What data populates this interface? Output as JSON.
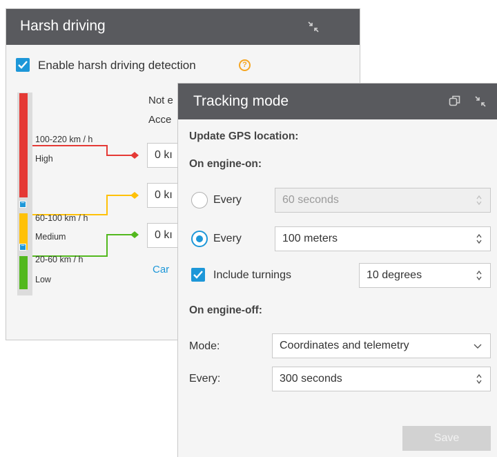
{
  "harsh": {
    "title": "Harsh driving",
    "enable_label": "Enable harsh driving detection",
    "help_glyph": "?",
    "cut_text_1": "Not e",
    "cut_text_2": "Acce",
    "ranges": [
      {
        "speed": "100-220 km / h",
        "level": "High",
        "color": "#e53935"
      },
      {
        "speed": "60-100 km / h",
        "level": "Medium",
        "color": "#ffc107"
      },
      {
        "speed": "20-60 km / h",
        "level": "Low",
        "color": "#52b81d"
      }
    ],
    "field_partial": [
      "0  kı",
      "0  kı",
      "0  kı"
    ],
    "link_partial": "Car",
    "minus_glyph": "−"
  },
  "tracking": {
    "title": "Tracking mode",
    "update_heading": "Update GPS location:",
    "engine_on_heading": "On engine-on:",
    "every_label": "Every",
    "every_seconds_value": "60  seconds",
    "every_meters_value": "100  meters",
    "include_turnings_label": "Include turnings",
    "degrees_value": "10  degrees",
    "engine_off_heading": "On engine-off:",
    "mode_label": "Mode:",
    "mode_value": "Coordinates and telemetry",
    "every_off_label": "Every:",
    "every_off_value": "300  seconds",
    "save_label": "Save"
  },
  "colors": {
    "header": "#595a5e",
    "accent": "#1d97d8",
    "help": "#f5a623"
  }
}
